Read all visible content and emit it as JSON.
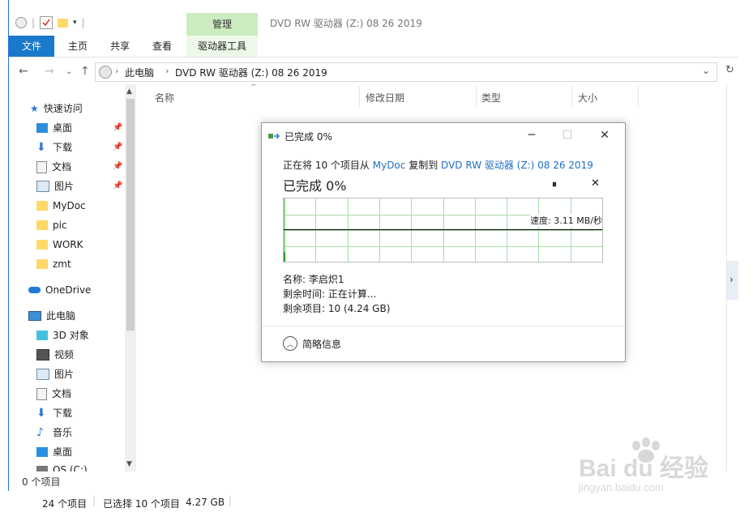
{
  "window": {
    "title": "DVD RW 驱动器 (Z:) 08 26 2019",
    "ribbon": {
      "context_group": "管理",
      "tabs": [
        "文件",
        "主页",
        "共享",
        "查看",
        "驱动器工具"
      ]
    },
    "address": {
      "path": [
        "此电脑",
        "DVD RW 驱动器 (Z:) 08 26 2019"
      ]
    },
    "columns": [
      "名称",
      "修改日期",
      "类型",
      "大小"
    ],
    "sidebar": {
      "quick_access": "快速访问",
      "pinned": [
        "桌面",
        "下载",
        "文档",
        "图片"
      ],
      "folders": [
        "MyDoc",
        "pic",
        "WORK",
        "zmt"
      ],
      "onedrive": "OneDrive",
      "this_pc": "此电脑",
      "pc_items": [
        "3D 对象",
        "视频",
        "图片",
        "文档",
        "下载",
        "音乐",
        "桌面",
        "OS (C:)"
      ]
    },
    "status_count": "0 个项目",
    "status_bar": {
      "total": "24 个项目",
      "selected": "已选择 10 个项目",
      "size": "4.27 GB"
    }
  },
  "dialog": {
    "title": "已完成 0%",
    "copy_prefix": "正在将 10 个项目从",
    "source": "MyDoc",
    "copy_mid": "复制到",
    "destination": "DVD RW 驱动器 (Z:) 08 26 2019",
    "progress_text": "已完成 0%",
    "progress_fraction": 0,
    "speed_label": "速度: 3.11 MB/秒",
    "name_label": "名称: 李启炽1",
    "time_label": "剩余时间: 正在计算...",
    "items_label": "剩余项目: 10 (4.24 GB)",
    "brief_label": "简略信息"
  },
  "watermark": {
    "logo": "Baidu 经验",
    "url": "jingyan.baidu.com"
  },
  "colors": {
    "file_tab": "#1979ca",
    "manage_tab": "#cdebc1",
    "link": "#1f6ec4",
    "graph_grid": "#a8dca8"
  }
}
